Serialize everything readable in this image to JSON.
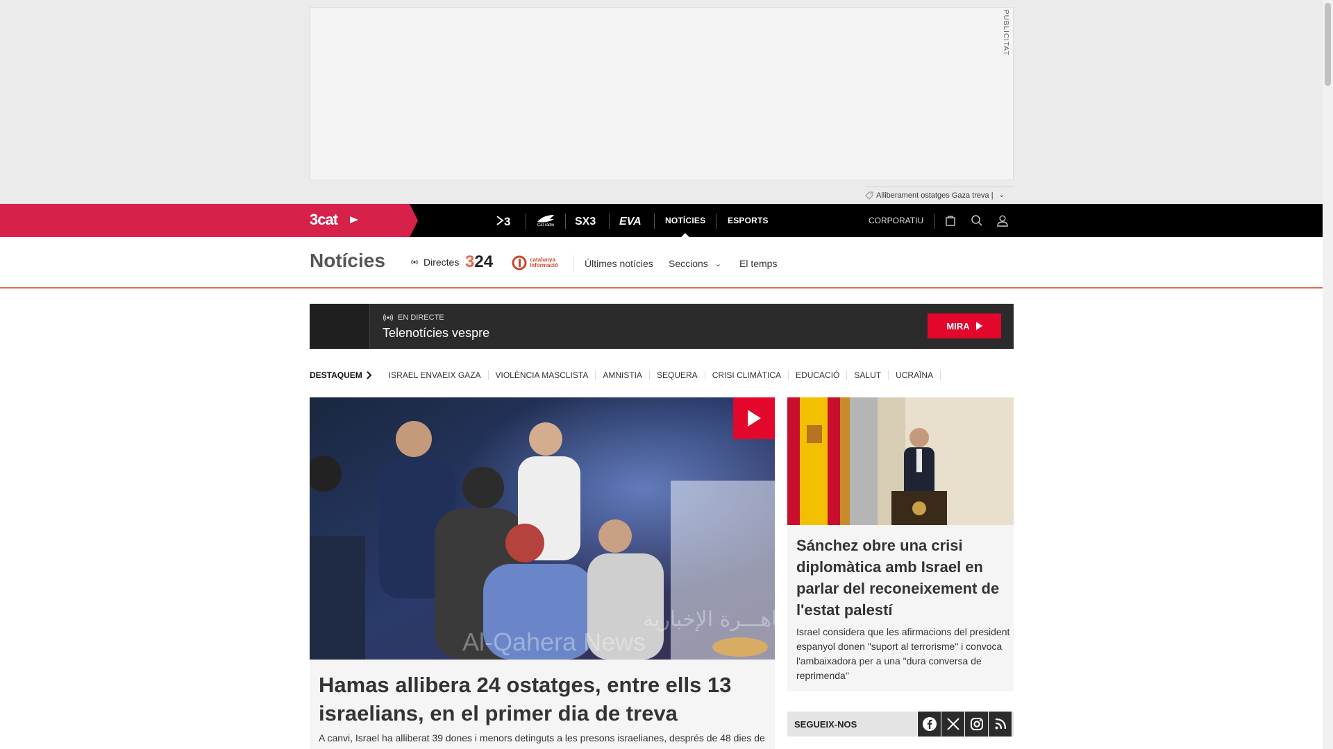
{
  "ad": {
    "label": "PUBLICITAT"
  },
  "ticker": {
    "text": "Alliberament ostatges Gaza treva |"
  },
  "mainnav": {
    "logo": "3cat",
    "channels": [
      "tv3-icon",
      "catradio-icon",
      "sx3-icon",
      "eva-icon"
    ],
    "catradio_label": "Cat ràdio",
    "links": [
      {
        "label": "NOTÍCIES",
        "active": true
      },
      {
        "label": "ESPORTS",
        "active": false
      }
    ],
    "corporatiu": "CORPORATIU"
  },
  "subnav": {
    "section_title": "Notícies",
    "directes": "Directes",
    "logo_324": {
      "three": "3",
      "rest": "24"
    },
    "logo_ci": {
      "line1": "catalunya",
      "line2": "informació"
    },
    "links": [
      "Últimes notícies",
      "Seccions",
      "El temps"
    ]
  },
  "live": {
    "badge": "EN DIRECTE",
    "program": "Telenotícies vespre",
    "cta": "MIRA"
  },
  "tags": {
    "label": "DESTAQUEM",
    "items": [
      "ISRAEL ENVAEIX GAZA",
      "VIOLÈNCIA MASCLISTA",
      "AMNISTIA",
      "SEQUERA",
      "CRISI CLIMÀTICA",
      "EDUCACIÓ",
      "SALUT",
      "UCRAÏNA"
    ]
  },
  "lead": {
    "watermark_ar": "القاهـــرة الإخبارية",
    "watermark_en": "Al-Qahera News",
    "title": "Hamas allibera 24 ostatges, entre ells 13 israelians, en el primer dia de treva",
    "summary": "A canvi, Israel ha alliberat 39 dones i menors detinguts a les presons israelianes, després de 48 dies de"
  },
  "side": {
    "title": "Sánchez obre una crisi diplomàtica amb Israel en parlar del reconeixement de l'estat palestí",
    "summary": "Israel considera que les afirmacions del president espanyol donen \"suport al terrorisme\" i convoca l'ambaixadora per a una \"dura conversa de reprimenda\""
  },
  "follow": {
    "label": "SEGUEIX-NOS",
    "networks": [
      "facebook-icon",
      "x-icon",
      "instagram-icon",
      "rss-icon"
    ]
  },
  "colors": {
    "brand": "#d6224a",
    "live_red": "#e3072c",
    "accent": "#e8674a"
  }
}
